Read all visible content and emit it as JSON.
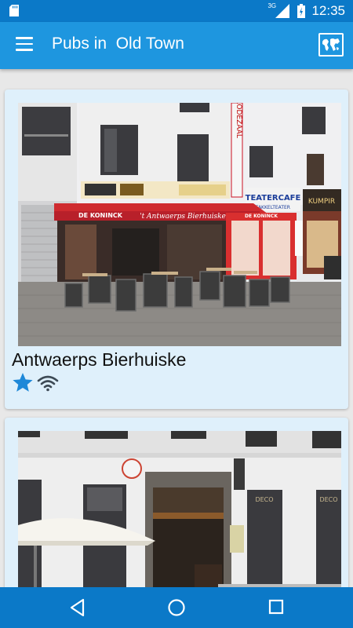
{
  "status_bar": {
    "network": "3G",
    "time": "12:35"
  },
  "app_bar": {
    "title": "Pubs in  Old Town"
  },
  "pubs": [
    {
      "name": "Antwaerps Bierhuiske",
      "sign_brand": "DE KONINCK",
      "sign_name": "'t Antwaerps Bierhuiske",
      "neighbor_sign": "TEATERCAFE",
      "neighbor_sub": "FAKKELTEATER",
      "shop_sign": "KUMPIR",
      "vertical_sign": "RODEZAAL",
      "favorite": true,
      "wifi": true
    },
    {
      "name": "",
      "window_text": "DECO"
    }
  ],
  "colors": {
    "status_bar": "#0b79c8",
    "app_bar": "#1e96df",
    "card": "#dff0fb",
    "star": "#1e88d8"
  }
}
